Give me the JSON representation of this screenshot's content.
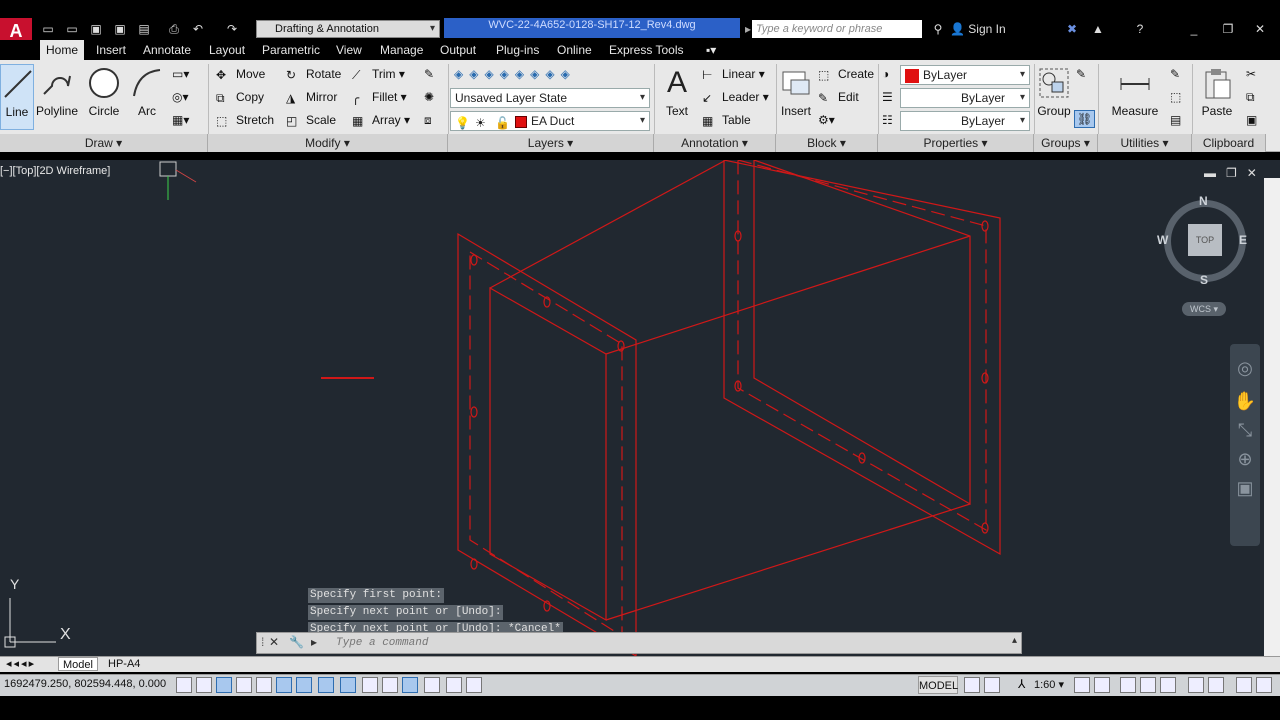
{
  "titlebar": {
    "app_logo": "A",
    "workspace": "Drafting & Annotation",
    "file_name": "WVC-22-4A652-0128-SH17-12_Rev4.dwg",
    "search_placeholder": "Type a keyword or phrase",
    "sign_in": "Sign In"
  },
  "tabs": [
    "Home",
    "Insert",
    "Annotate",
    "Layout",
    "Parametric",
    "View",
    "Manage",
    "Output",
    "Plug-ins",
    "Online",
    "Express Tools"
  ],
  "active_tab": "Home",
  "ribbon": {
    "draw": {
      "line": "Line",
      "polyline": "Polyline",
      "circle": "Circle",
      "arc": "Arc"
    },
    "modify": {
      "move": "Move",
      "rotate": "Rotate",
      "trim": "Trim",
      "copy": "Copy",
      "mirror": "Mirror",
      "fillet": "Fillet",
      "stretch": "Stretch",
      "scale": "Scale",
      "array": "Array"
    },
    "layers": {
      "layer_state": "Unsaved Layer State",
      "current_layer": "EA Duct",
      "layer_color": "#e01010"
    },
    "annotation": {
      "text": "Text",
      "linear": "Linear",
      "leader": "Leader",
      "table": "Table"
    },
    "block": {
      "insert": "Insert",
      "create": "Create",
      "edit": "Edit"
    },
    "properties": {
      "color": "ByLayer",
      "linetype": "ByLayer",
      "lineweight": "ByLayer",
      "color_swatch": "#e01010"
    },
    "groups": {
      "group": "Group"
    },
    "utilities": {
      "measure": "Measure"
    },
    "clipboard": {
      "paste": "Paste"
    }
  },
  "panels": [
    "Draw",
    "Modify",
    "Layers",
    "Annotation",
    "Block",
    "Properties",
    "Groups",
    "Utilities",
    "Clipboard"
  ],
  "viewport": {
    "label": "[−][Top][2D Wireframe]"
  },
  "viewcube": {
    "n": "N",
    "s": "S",
    "e": "E",
    "w": "W",
    "face": "TOP",
    "wcs": "WCS"
  },
  "ucs": {
    "y": "Y",
    "x": "X"
  },
  "command": {
    "history": [
      "Specify first point:",
      "Specify next point or [Undo]:",
      "Specify next point or [Undo]: *Cancel*"
    ],
    "placeholder": "Type a command"
  },
  "layout_tabs": [
    "Model",
    "HP-A4"
  ],
  "status": {
    "coords": "1692479.250, 802594.448, 0.000",
    "space": "MODEL",
    "scale": "1:60"
  },
  "drawing_color": "#d01818",
  "canvas_bg": "#212830"
}
